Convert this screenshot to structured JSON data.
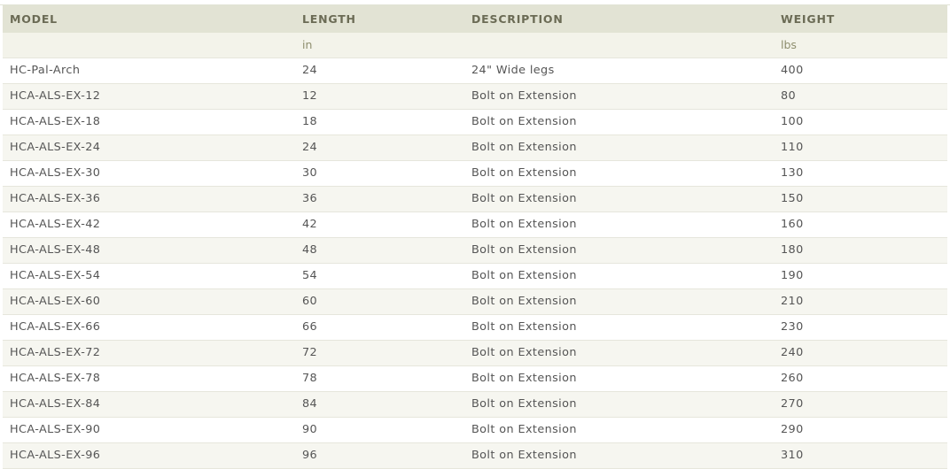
{
  "table": {
    "headers": [
      "MODEL",
      "LENGTH",
      "DESCRIPTION",
      "WEIGHT"
    ],
    "units": [
      "",
      "in",
      "",
      "lbs"
    ],
    "rows": [
      [
        "HC-Pal-Arch",
        "24",
        "24\" Wide legs",
        "400"
      ],
      [
        "HCA-ALS-EX-12",
        "12",
        "Bolt on Extension",
        "80"
      ],
      [
        "HCA-ALS-EX-18",
        "18",
        "Bolt on Extension",
        "100"
      ],
      [
        "HCA-ALS-EX-24",
        "24",
        "Bolt on Extension",
        "110"
      ],
      [
        "HCA-ALS-EX-30",
        "30",
        "Bolt on Extension",
        "130"
      ],
      [
        "HCA-ALS-EX-36",
        "36",
        "Bolt on Extension",
        "150"
      ],
      [
        "HCA-ALS-EX-42",
        "42",
        "Bolt on Extension",
        "160"
      ],
      [
        "HCA-ALS-EX-48",
        "48",
        "Bolt on Extension",
        "180"
      ],
      [
        "HCA-ALS-EX-54",
        "54",
        "Bolt on Extension",
        "190"
      ],
      [
        "HCA-ALS-EX-60",
        "60",
        "Bolt on Extension",
        "210"
      ],
      [
        "HCA-ALS-EX-66",
        "66",
        "Bolt on Extension",
        "230"
      ],
      [
        "HCA-ALS-EX-72",
        "72",
        "Bolt on Extension",
        "240"
      ],
      [
        "HCA-ALS-EX-78",
        "78",
        "Bolt on Extension",
        "260"
      ],
      [
        "HCA-ALS-EX-84",
        "84",
        "Bolt on Extension",
        "270"
      ],
      [
        "HCA-ALS-EX-90",
        "90",
        "Bolt on Extension",
        "290"
      ],
      [
        "HCA-ALS-EX-96",
        "96",
        "Bolt on Extension",
        "310"
      ]
    ]
  },
  "colors": {
    "header_bg": "#e2e3d4",
    "header_text": "#6b6b55",
    "units_bg": "#f3f3ea",
    "units_text": "#8e8e6e",
    "row_text": "#555555",
    "row_alt_bg": "#f6f6f0",
    "row_border": "#e6e6dc"
  }
}
